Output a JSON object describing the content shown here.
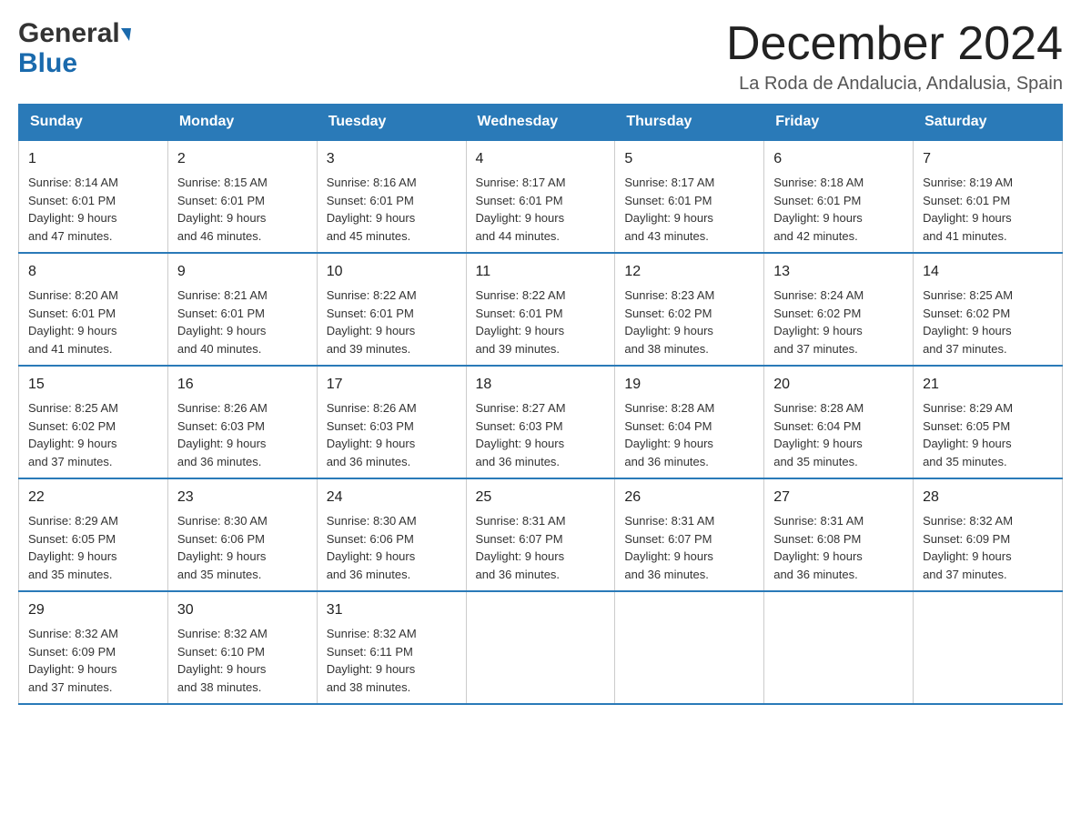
{
  "header": {
    "month_title": "December 2024",
    "location": "La Roda de Andalucia, Andalusia, Spain",
    "logo_general": "General",
    "logo_blue": "Blue"
  },
  "calendar": {
    "days_of_week": [
      "Sunday",
      "Monday",
      "Tuesday",
      "Wednesday",
      "Thursday",
      "Friday",
      "Saturday"
    ],
    "weeks": [
      [
        {
          "day": "1",
          "sunrise": "8:14 AM",
          "sunset": "6:01 PM",
          "daylight": "9 hours and 47 minutes."
        },
        {
          "day": "2",
          "sunrise": "8:15 AM",
          "sunset": "6:01 PM",
          "daylight": "9 hours and 46 minutes."
        },
        {
          "day": "3",
          "sunrise": "8:16 AM",
          "sunset": "6:01 PM",
          "daylight": "9 hours and 45 minutes."
        },
        {
          "day": "4",
          "sunrise": "8:17 AM",
          "sunset": "6:01 PM",
          "daylight": "9 hours and 44 minutes."
        },
        {
          "day": "5",
          "sunrise": "8:17 AM",
          "sunset": "6:01 PM",
          "daylight": "9 hours and 43 minutes."
        },
        {
          "day": "6",
          "sunrise": "8:18 AM",
          "sunset": "6:01 PM",
          "daylight": "9 hours and 42 minutes."
        },
        {
          "day": "7",
          "sunrise": "8:19 AM",
          "sunset": "6:01 PM",
          "daylight": "9 hours and 41 minutes."
        }
      ],
      [
        {
          "day": "8",
          "sunrise": "8:20 AM",
          "sunset": "6:01 PM",
          "daylight": "9 hours and 41 minutes."
        },
        {
          "day": "9",
          "sunrise": "8:21 AM",
          "sunset": "6:01 PM",
          "daylight": "9 hours and 40 minutes."
        },
        {
          "day": "10",
          "sunrise": "8:22 AM",
          "sunset": "6:01 PM",
          "daylight": "9 hours and 39 minutes."
        },
        {
          "day": "11",
          "sunrise": "8:22 AM",
          "sunset": "6:01 PM",
          "daylight": "9 hours and 39 minutes."
        },
        {
          "day": "12",
          "sunrise": "8:23 AM",
          "sunset": "6:02 PM",
          "daylight": "9 hours and 38 minutes."
        },
        {
          "day": "13",
          "sunrise": "8:24 AM",
          "sunset": "6:02 PM",
          "daylight": "9 hours and 37 minutes."
        },
        {
          "day": "14",
          "sunrise": "8:25 AM",
          "sunset": "6:02 PM",
          "daylight": "9 hours and 37 minutes."
        }
      ],
      [
        {
          "day": "15",
          "sunrise": "8:25 AM",
          "sunset": "6:02 PM",
          "daylight": "9 hours and 37 minutes."
        },
        {
          "day": "16",
          "sunrise": "8:26 AM",
          "sunset": "6:03 PM",
          "daylight": "9 hours and 36 minutes."
        },
        {
          "day": "17",
          "sunrise": "8:26 AM",
          "sunset": "6:03 PM",
          "daylight": "9 hours and 36 minutes."
        },
        {
          "day": "18",
          "sunrise": "8:27 AM",
          "sunset": "6:03 PM",
          "daylight": "9 hours and 36 minutes."
        },
        {
          "day": "19",
          "sunrise": "8:28 AM",
          "sunset": "6:04 PM",
          "daylight": "9 hours and 36 minutes."
        },
        {
          "day": "20",
          "sunrise": "8:28 AM",
          "sunset": "6:04 PM",
          "daylight": "9 hours and 35 minutes."
        },
        {
          "day": "21",
          "sunrise": "8:29 AM",
          "sunset": "6:05 PM",
          "daylight": "9 hours and 35 minutes."
        }
      ],
      [
        {
          "day": "22",
          "sunrise": "8:29 AM",
          "sunset": "6:05 PM",
          "daylight": "9 hours and 35 minutes."
        },
        {
          "day": "23",
          "sunrise": "8:30 AM",
          "sunset": "6:06 PM",
          "daylight": "9 hours and 35 minutes."
        },
        {
          "day": "24",
          "sunrise": "8:30 AM",
          "sunset": "6:06 PM",
          "daylight": "9 hours and 36 minutes."
        },
        {
          "day": "25",
          "sunrise": "8:31 AM",
          "sunset": "6:07 PM",
          "daylight": "9 hours and 36 minutes."
        },
        {
          "day": "26",
          "sunrise": "8:31 AM",
          "sunset": "6:07 PM",
          "daylight": "9 hours and 36 minutes."
        },
        {
          "day": "27",
          "sunrise": "8:31 AM",
          "sunset": "6:08 PM",
          "daylight": "9 hours and 36 minutes."
        },
        {
          "day": "28",
          "sunrise": "8:32 AM",
          "sunset": "6:09 PM",
          "daylight": "9 hours and 37 minutes."
        }
      ],
      [
        {
          "day": "29",
          "sunrise": "8:32 AM",
          "sunset": "6:09 PM",
          "daylight": "9 hours and 37 minutes."
        },
        {
          "day": "30",
          "sunrise": "8:32 AM",
          "sunset": "6:10 PM",
          "daylight": "9 hours and 38 minutes."
        },
        {
          "day": "31",
          "sunrise": "8:32 AM",
          "sunset": "6:11 PM",
          "daylight": "9 hours and 38 minutes."
        },
        null,
        null,
        null,
        null
      ]
    ],
    "labels": {
      "sunrise": "Sunrise:",
      "sunset": "Sunset:",
      "daylight": "Daylight:"
    }
  }
}
